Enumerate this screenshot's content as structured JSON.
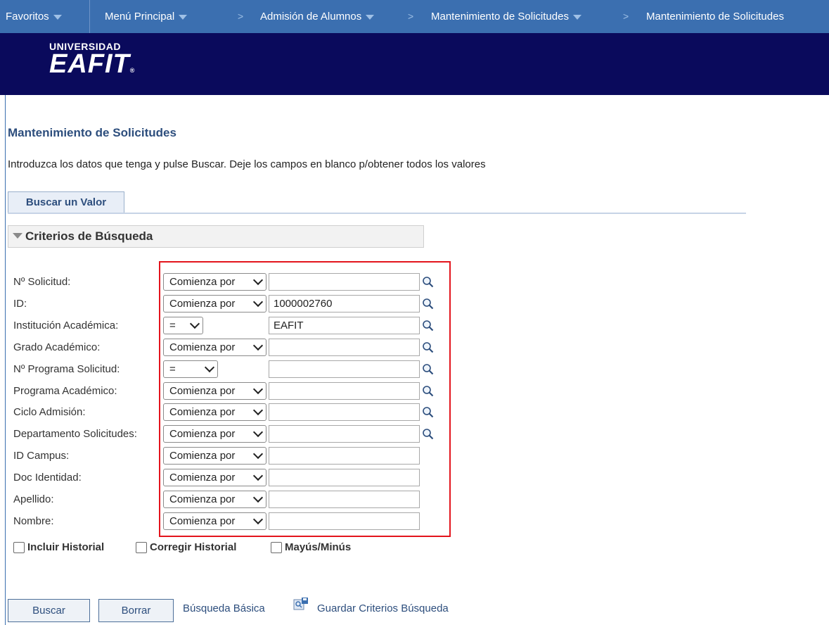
{
  "topnav": {
    "favorites": "Favoritos",
    "main_menu": "Menú Principal",
    "crumbs": [
      "Admisión de Alumnos",
      "Mantenimiento de Solicitudes",
      "Mantenimiento de Solicitudes"
    ],
    "separator": ">"
  },
  "logo": {
    "line1": "UNIVERSIDAD",
    "line2": "EAFIT",
    "mark": "®"
  },
  "page": {
    "title": "Mantenimiento de Solicitudes",
    "instructions": "Introduzca los datos que tenga y pulse Buscar. Deje los campos en blanco p/obtener todos los valores"
  },
  "tab": {
    "label": "Buscar un Valor"
  },
  "section": {
    "title": "Criterios de Búsqueda"
  },
  "fields": [
    {
      "label": "Nº Solicitud:",
      "operator": "Comienza por",
      "value": "",
      "lookup": true
    },
    {
      "label": "ID:",
      "operator": "Comienza por",
      "value": "1000002760",
      "lookup": true
    },
    {
      "label": "Institución Académica:",
      "operator": "=",
      "value": "EAFIT",
      "lookup": true
    },
    {
      "label": "Grado Académico:",
      "operator": "Comienza por",
      "value": "",
      "lookup": true
    },
    {
      "label": "Nº Programa Solicitud:",
      "operator": "=",
      "value": "",
      "lookup": true
    },
    {
      "label": "Programa Académico:",
      "operator": "Comienza por",
      "value": "",
      "lookup": true
    },
    {
      "label": "Ciclo Admisión:",
      "operator": "Comienza por",
      "value": "",
      "lookup": true
    },
    {
      "label": "Departamento Solicitudes:",
      "operator": "Comienza por",
      "value": "",
      "lookup": true
    },
    {
      "label": "ID Campus:",
      "operator": "Comienza por",
      "value": "",
      "lookup": false
    },
    {
      "label": "Doc Identidad:",
      "operator": "Comienza por",
      "value": "",
      "lookup": false
    },
    {
      "label": "Apellido:",
      "operator": "Comienza por",
      "value": "",
      "lookup": false
    },
    {
      "label": "Nombre:",
      "operator": "Comienza por",
      "value": "",
      "lookup": false
    }
  ],
  "checkboxes": {
    "include_history": "Incluir Historial",
    "correct_history": "Corregir Historial",
    "case_sensitive": "Mayús/Minús"
  },
  "actions": {
    "search": "Buscar",
    "clear": "Borrar",
    "basic_search": "Búsqueda Básica",
    "save_criteria": "Guardar Criterios Búsqueda"
  },
  "colors": {
    "nav": "#3b6fb0",
    "banner": "#0a0a5c",
    "highlight": "#e3141c",
    "title": "#2d4e7d"
  },
  "icons": [
    "chevron-down-icon",
    "magnifier-lookup-icon",
    "save-search-icon"
  ]
}
